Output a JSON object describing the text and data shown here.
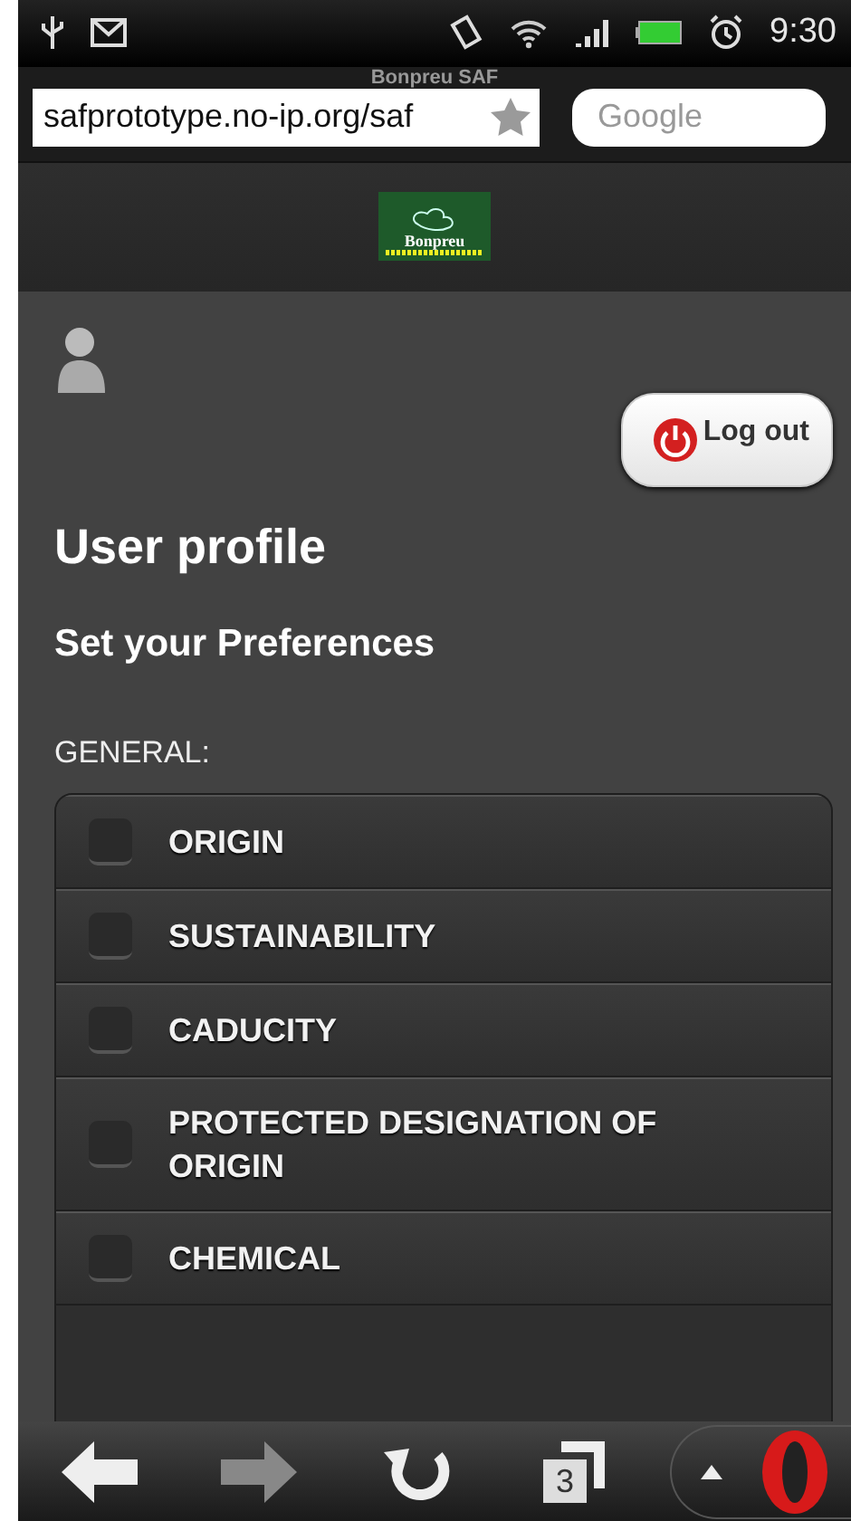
{
  "status_bar": {
    "time": "9:30"
  },
  "browser": {
    "page_title": "Bonpreu SAF",
    "url": "safprototype.no-ip.org/saf",
    "search": {
      "placeholder": "Google"
    }
  },
  "header": {
    "logo_text": "Bonpreu"
  },
  "logout_button": {
    "label": "Log out"
  },
  "page": {
    "title": "User profile",
    "subtitle": "Set your Preferences",
    "section": "GENERAL:"
  },
  "preferences": [
    {
      "label": "ORIGIN",
      "checked": false
    },
    {
      "label": "SUSTAINABILITY",
      "checked": false
    },
    {
      "label": "CADUCITY",
      "checked": false
    },
    {
      "label": "PROTECTED DESIGNATION OF ORIGIN",
      "checked": false
    },
    {
      "label": "CHEMICAL",
      "checked": false
    }
  ],
  "toolbar": {
    "tab_count": "3"
  }
}
